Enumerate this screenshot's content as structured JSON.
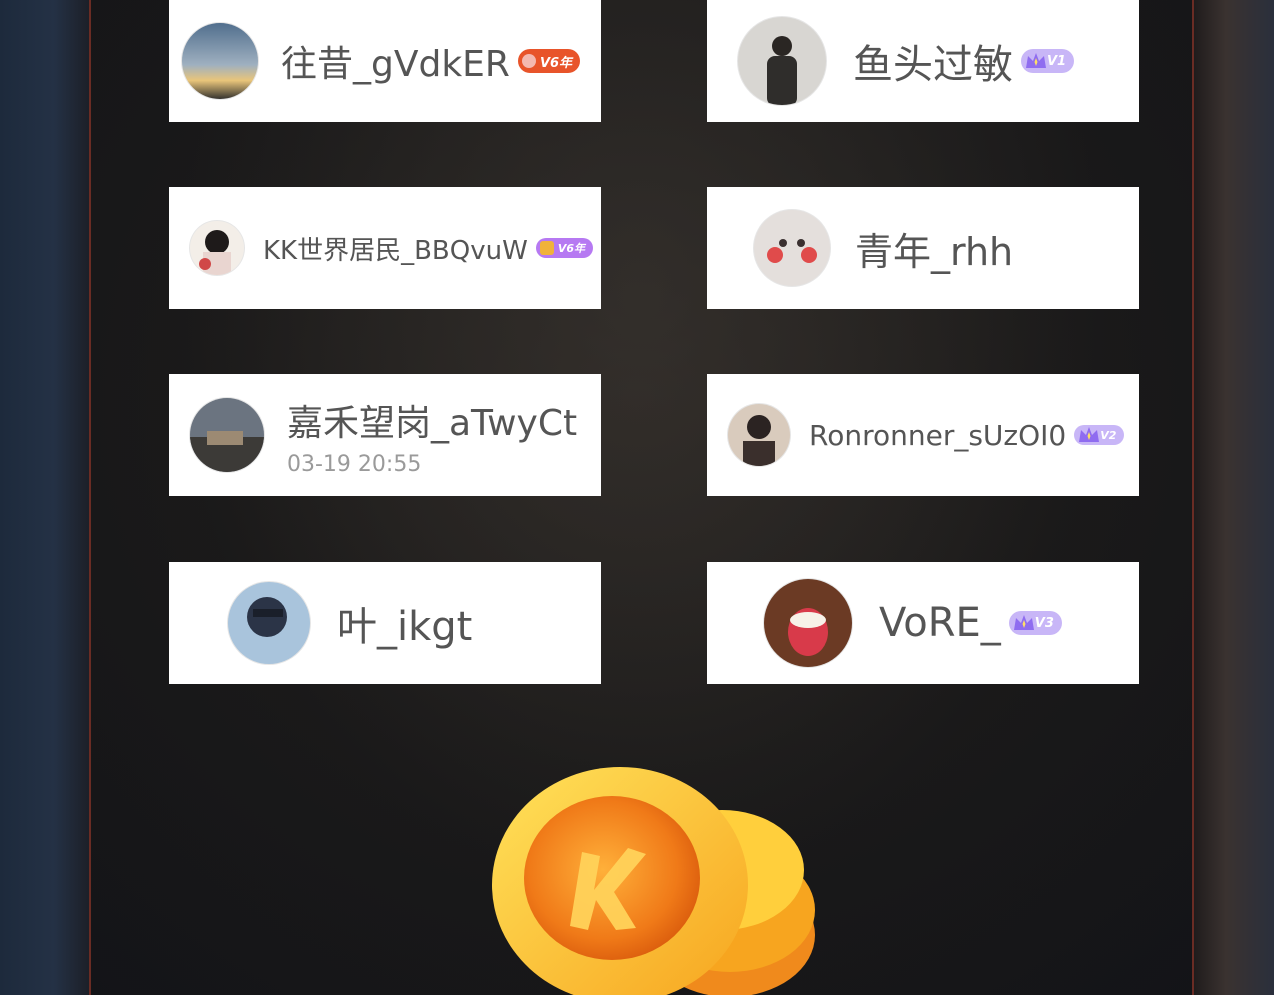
{
  "users": [
    {
      "name": "往昔_gVdkER",
      "badge": "V6年",
      "badge_color": "#e8542a"
    },
    {
      "name": "鱼头过敏",
      "badge": "V1",
      "badge_color": "#9a7cf0"
    },
    {
      "name": "KK世界居民_BBQvuW",
      "badge": "V6年",
      "badge_color": "#b679f2"
    },
    {
      "name": "青年_rhh"
    },
    {
      "name": "嘉禾望岗_aTwyCt",
      "time": "03-19 20:55"
    },
    {
      "name": "Ronronner_sUzOI0",
      "badge": "V2",
      "badge_color": "#9a7cf0"
    },
    {
      "name": "叶_ikgt"
    },
    {
      "name": "VoRE_",
      "badge": "V3",
      "badge_color": "#9a7cf0"
    }
  ],
  "coin_icon": "k-coin-stack-icon",
  "colors": {
    "frame": "#6a2c24",
    "card": "#ffffff",
    "text": "#555555"
  }
}
